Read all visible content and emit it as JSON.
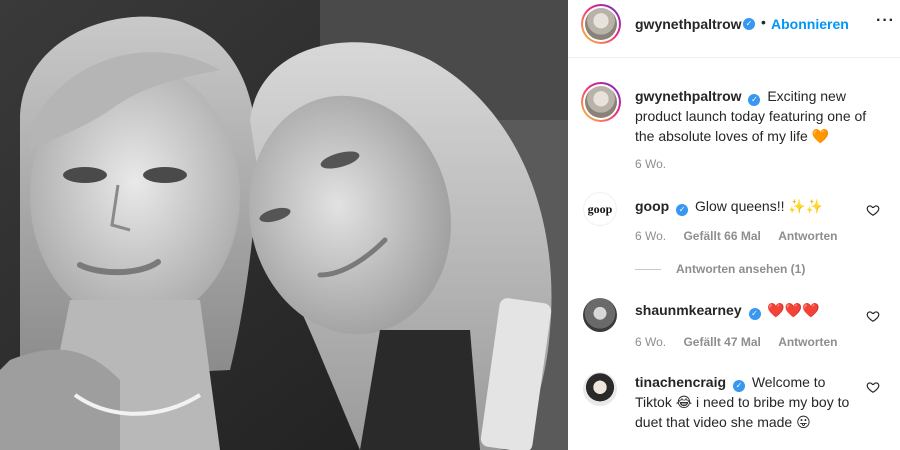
{
  "post": {
    "photo_alt": "Schwarz-Weiß-Selfie zweier Frauen"
  },
  "header": {
    "username": "gwynethpaltrow",
    "follow_label": "Abonnieren",
    "more_icon": "more-options-icon"
  },
  "caption": {
    "username": "gwynethpaltrow",
    "text": "Exciting new product launch today featuring one of the absolute loves of my life",
    "emoji": "🧡",
    "time": "6 Wo."
  },
  "comments": [
    {
      "username": "goop",
      "avatar_text": "goop",
      "text": "Glow queens!! ✨✨",
      "time": "6 Wo.",
      "likes": "Gefällt 66 Mal",
      "reply": "Antworten",
      "view_replies": "Antworten ansehen (1)"
    },
    {
      "username": "shaunmkearney",
      "text": "❤️❤️❤️",
      "time": "6 Wo.",
      "likes": "Gefällt 47 Mal",
      "reply": "Antworten"
    },
    {
      "username": "tinachencraig",
      "text": "Welcome to Tiktok 😂 i need to bribe my boy to duet that video she made 😛"
    }
  ],
  "colors": {
    "accent": "#0095f6",
    "verified": "#3897f0",
    "muted": "#8e8e8e",
    "text": "#262626"
  }
}
